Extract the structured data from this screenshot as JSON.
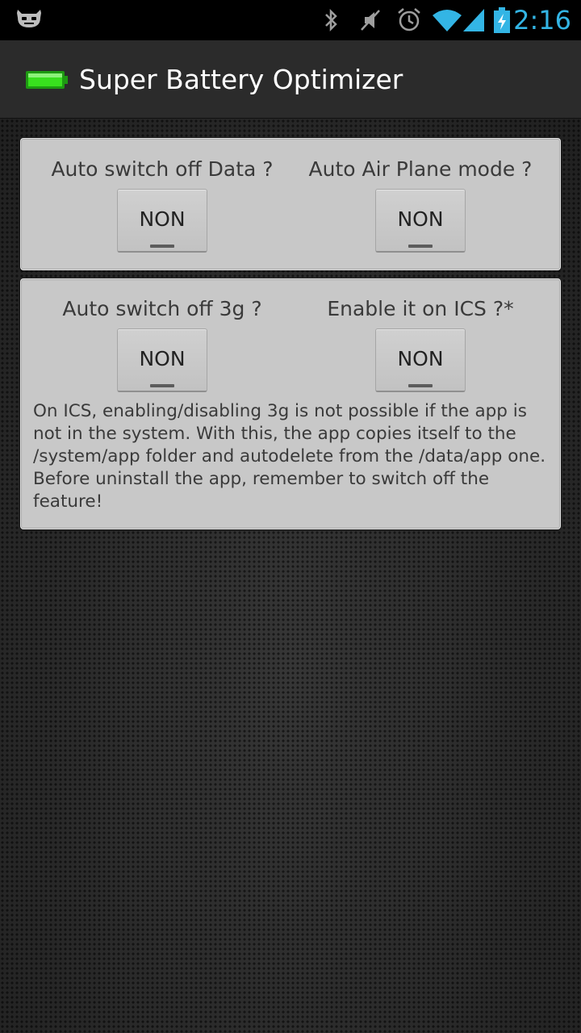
{
  "status_bar": {
    "icons": [
      "cyanogenmod-icon",
      "bluetooth-icon",
      "mute-icon",
      "alarm-icon",
      "wifi-icon",
      "signal-icon",
      "battery-charging-icon"
    ],
    "time": "2:16",
    "accent_color": "#33b5e5"
  },
  "action_bar": {
    "icon": "battery-icon",
    "title": "Super Battery Optimizer"
  },
  "panel1": {
    "data_label": "Auto switch off Data ?",
    "data_value": "NON",
    "airplane_label": "Auto Air Plane mode ?",
    "airplane_value": "NON"
  },
  "panel2": {
    "g3_label": "Auto switch off 3g ?",
    "g3_value": "NON",
    "ics_label": "Enable it on ICS ?*",
    "ics_value": "NON",
    "note": "On ICS, enabling/disabling 3g is not possible if the app is not in the system. With this, the app copies itself to the /system/app folder and autodelete from the /data/app one. Before uninstall the app, remember to switch off the feature!"
  }
}
